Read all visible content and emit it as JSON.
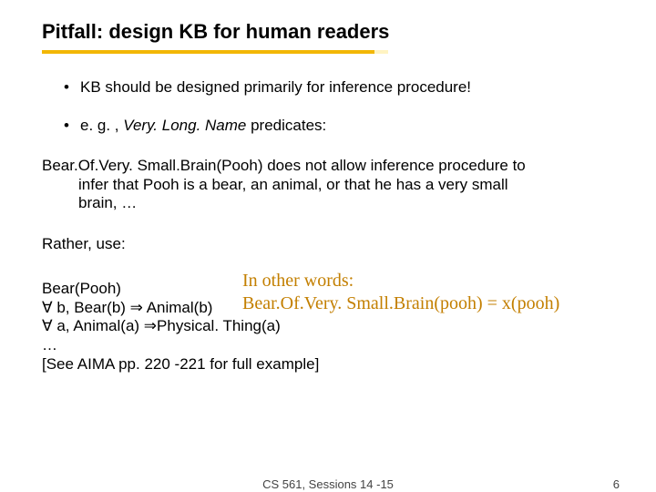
{
  "title": "Pitfall: design KB for human readers",
  "bullet1_a": "KB should be designed primarily for inference procedure!",
  "bullet2_a": "e. g. , ",
  "bullet2_b": "Very. Long. Name",
  "bullet2_c": " predicates:",
  "para1_a": "Bear.Of.Very. Small.Brain(Pooh) does not allow inference procedure to",
  "para1_b": "infer that Pooh is a bear, an animal, or that he has a very small",
  "para1_c": "brain, …",
  "rather": "Rather, use:",
  "callout1": "In other words:",
  "callout2": "Bear.Of.Very. Small.Brain(pooh) = x(pooh)",
  "l1": "Bear(Pooh)",
  "l2": "∀  b, Bear(b) ⇒ Animal(b)",
  "l3": "∀  a, Animal(a) ⇒Physical. Thing(a)",
  "l4": "…",
  "l5": "[See AIMA pp. 220 -221 for full example]",
  "footer_center": "CS 561,  Sessions 14 -15",
  "footer_page": "6"
}
